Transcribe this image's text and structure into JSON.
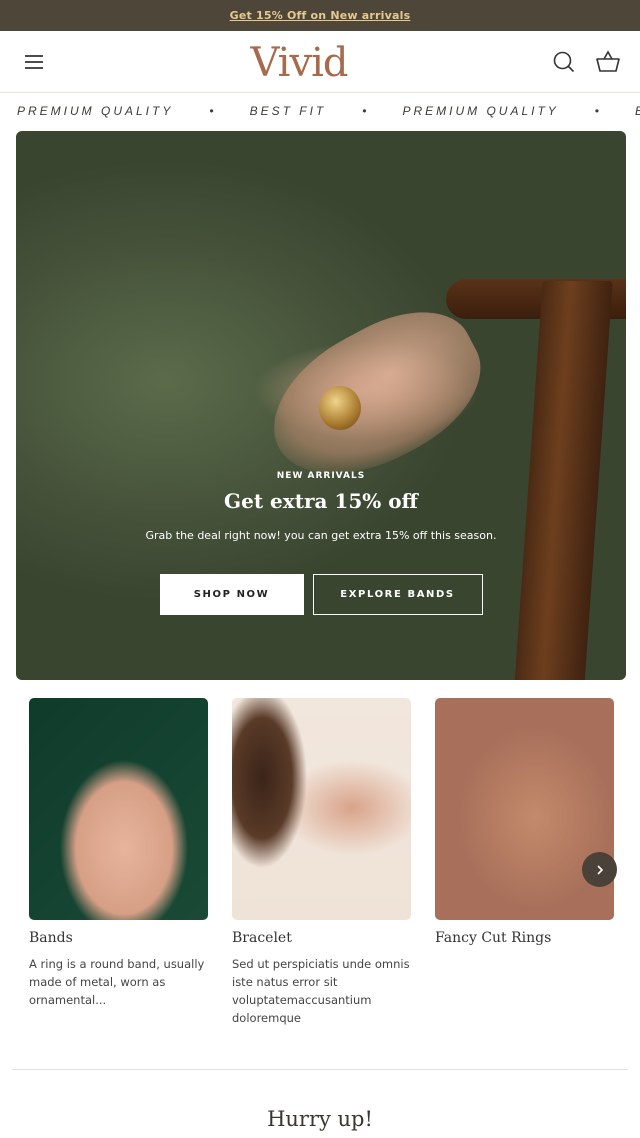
{
  "announcement": {
    "text": "Get 15% Off on New arrivals"
  },
  "header": {
    "logo": "Vivid"
  },
  "marquee": {
    "items": [
      "PREMIUM QUALITY",
      "•",
      "BEST FIT",
      "•",
      "PREMIUM QUALITY",
      "•",
      "B"
    ]
  },
  "hero": {
    "subtitle": "NEW ARRIVALS",
    "title": "Get extra 15% off",
    "description": "Grab the deal right now! you can get extra 15% off this season.",
    "primary_button": "SHOP NOW",
    "secondary_button": "EXPLORE BANDS"
  },
  "categories": [
    {
      "title": "Bands",
      "description": "A ring is a round band, usually made of metal, worn as ornamental..."
    },
    {
      "title": "Bracelet",
      "description": "Sed ut perspiciatis unde omnis iste natus error sit voluptatemaccusantium doloremque"
    },
    {
      "title": "Fancy Cut Rings",
      "description": ""
    }
  ],
  "section": {
    "heading": "Hurry up!"
  },
  "colors": {
    "announcement_bg": "#4d4639",
    "announcement_text": "#e7c88f",
    "logo": "#a66b4c",
    "arrow_bg": "#4a4238"
  },
  "icons": {
    "menu": "hamburger-icon",
    "search": "search-icon",
    "cart": "basket-icon",
    "next": "chevron-right-icon"
  }
}
